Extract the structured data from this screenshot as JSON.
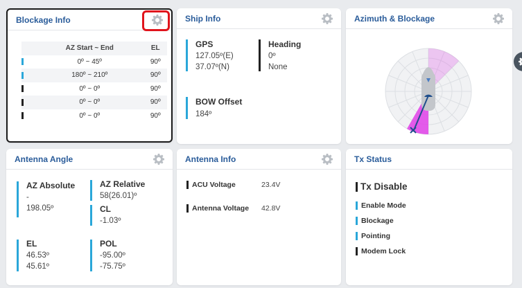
{
  "blockage_info": {
    "title": "Blockage Info",
    "columns": [
      "AZ Start ~ End",
      "EL"
    ],
    "rows": [
      {
        "range": "0º ~ 45º",
        "el": "90º",
        "color": "#2aa7d9"
      },
      {
        "range": "180º ~ 210º",
        "el": "90º",
        "color": "#2aa7d9"
      },
      {
        "range": "0º ~ 0º",
        "el": "90º",
        "color": "#222222"
      },
      {
        "range": "0º ~ 0º",
        "el": "90º",
        "color": "#222222"
      },
      {
        "range": "0º ~ 0º",
        "el": "90º",
        "color": "#222222"
      }
    ]
  },
  "ship_info": {
    "title": "Ship Info",
    "gps_label": "GPS",
    "gps_lon": "127.05º(E)",
    "gps_lat": "37.07º(N)",
    "heading_label": "Heading",
    "heading_value": "0º",
    "heading_extra": "None",
    "bow_label": "BOW Offset",
    "bow_value": "184º"
  },
  "azimuth_blockage": {
    "title": "Azimuth & Blockage"
  },
  "antenna_angle": {
    "title": "Antenna Angle",
    "az_abs_label": "AZ Absolute",
    "az_abs_dash": "-",
    "az_abs_value": "198.05º",
    "az_rel_label": "AZ Relative",
    "az_rel_value": "58(26.01)º",
    "cl_label": "CL",
    "cl_value": "-1.03º",
    "el_label": "EL",
    "el_value1": "46.53º",
    "el_value2": "45.61º",
    "pol_label": "POL",
    "pol_value1": "-95.00º",
    "pol_value2": "-75.75º"
  },
  "antenna_info": {
    "title": "Antenna Info",
    "acu_label": "ACU Voltage",
    "acu_value": "23.4V",
    "ant_label": "Antenna Voltage",
    "ant_value": "42.8V"
  },
  "tx_status": {
    "title": "Tx Status",
    "state": "Tx Disable",
    "items": [
      "Enable Mode",
      "Blockage",
      "Pointing",
      "Modem Lock"
    ]
  },
  "colors": {
    "accent": "#2aa7d9",
    "title": "#2a5c9a",
    "highlight": "#e0141c",
    "blockage_fill": "#e040e8"
  }
}
